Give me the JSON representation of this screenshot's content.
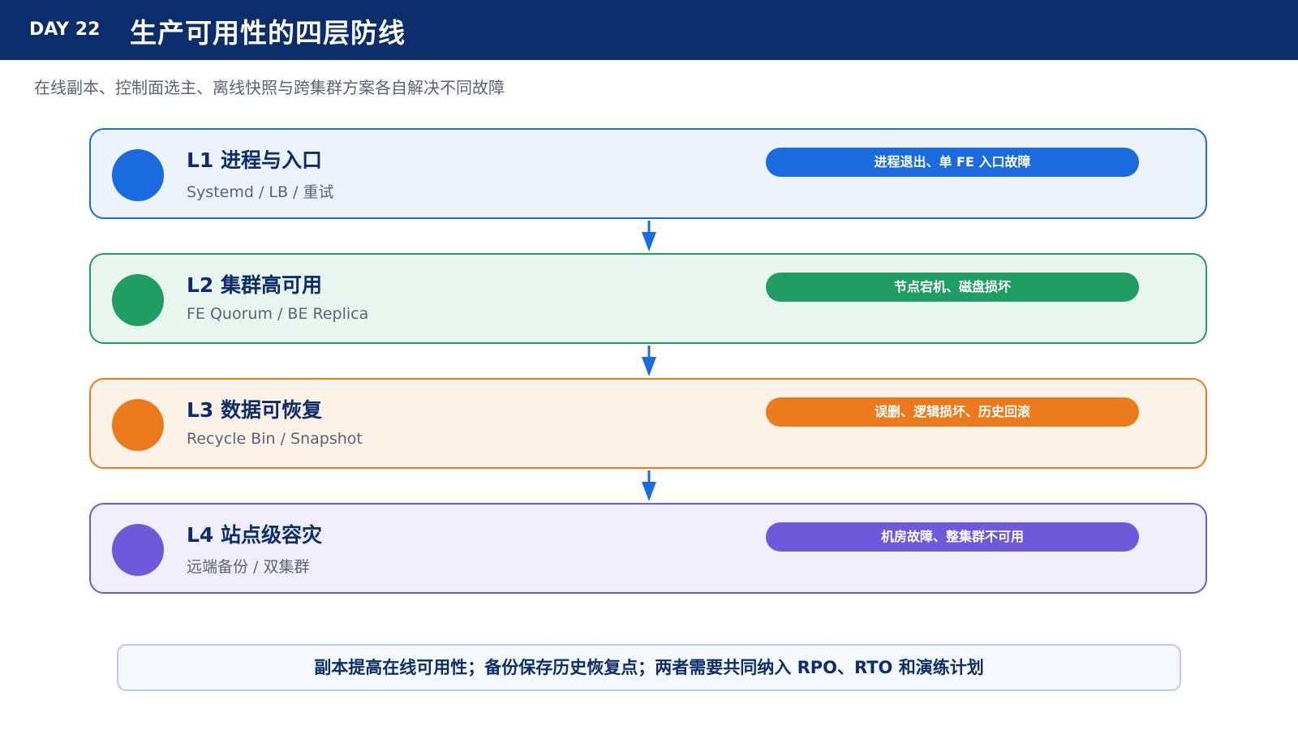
{
  "header": {
    "day": "DAY 22",
    "title": "生产可用性的四层防线"
  },
  "subtitle": "在线副本、控制面选主、离线快照与跨集群方案各自解决不同故障",
  "layers": [
    {
      "title": "L1 进程与入口",
      "desc": "Systemd / LB / 重试",
      "tag": "进程退出、单 FE 入口故障",
      "color": "#1a6ae0",
      "bg": "#ecf3fd"
    },
    {
      "title": "L2 集群高可用",
      "desc": "FE Quorum / BE Replica",
      "tag": "节点宕机、磁盘损坏",
      "color": "#1f9d62",
      "bg": "#e8f6ef"
    },
    {
      "title": "L3 数据可恢复",
      "desc": "Recycle Bin / Snapshot",
      "tag": "误删、逻辑损坏、历史回滚",
      "color": "#ea7a1c",
      "bg": "#fdf2e7"
    },
    {
      "title": "L4 站点级容灾",
      "desc": "远端备份 / 双集群",
      "tag": "机房故障、整集群不可用",
      "color": "#6f59db",
      "bg": "#f1eefc"
    }
  ],
  "arrow_color": "#1a6ae0",
  "note": "副本提高在线可用性；备份保存历史恢复点；两者需要共同纳入 RPO、RTO 和演练计划"
}
